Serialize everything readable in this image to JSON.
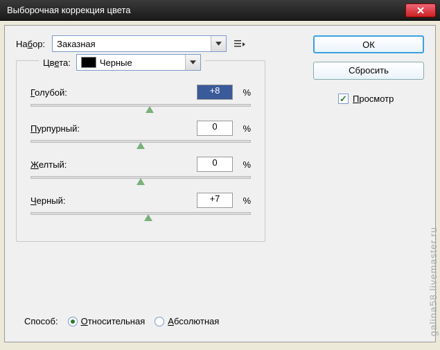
{
  "title": "Выборочная коррекция цвета",
  "preset": {
    "label": "Набор:",
    "value": "Заказная"
  },
  "colors": {
    "label": "Цвета:",
    "value": "Черные"
  },
  "buttons": {
    "ok": "ОК",
    "reset": "Сбросить"
  },
  "preview": {
    "label": "Просмотр",
    "checked": true
  },
  "sliders": {
    "cyan": {
      "label": "Голубой:",
      "value": "+8",
      "pos": 54
    },
    "magenta": {
      "label": "Пурпурный:",
      "value": "0",
      "pos": 50
    },
    "yellow": {
      "label": "Желтый:",
      "value": "0",
      "pos": 50
    },
    "black": {
      "label": "Черный:",
      "value": "+7",
      "pos": 53.5
    }
  },
  "method": {
    "label": "Способ:",
    "relative": "Относительная",
    "absolute": "Абсолютная",
    "selected": "relative"
  },
  "pct": "%",
  "watermark": "galina58.livemaster.ru"
}
